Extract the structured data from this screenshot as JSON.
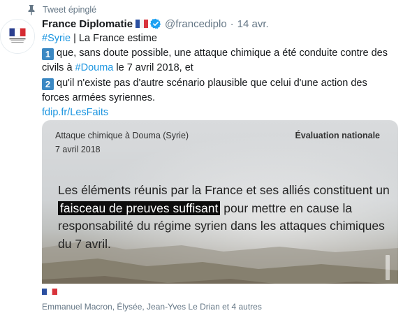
{
  "pinned": {
    "label": "Tweet épinglé"
  },
  "author": {
    "name": "France Diplomatie",
    "handle": "@francediplo",
    "separator": "·",
    "time": "14 avr."
  },
  "tweet": {
    "line1_tag": "#Syrie",
    "line1_rest": " | La France estime",
    "num1": "1",
    "point1_a": "que, sans doute possible, une attaque chimique a été conduite contre des civils à ",
    "point1_tag": "#Douma",
    "point1_b": " le 7 avril 2018, et",
    "num2": "2",
    "point2": "qu'il n'existe pas d'autre scénario plausible que celui d'une action des forces armées syriennes.",
    "link": "fdip.fr/LesFaits"
  },
  "media": {
    "title": "Attaque chimique à Douma (Syrie)",
    "date": "7 avril 2018",
    "badge": "Évaluation nationale",
    "text_a": "Les éléments réunis par la France et ses alliés constituent un ",
    "text_highlight": "faisceau de preuves suffisant",
    "text_b": " pour mettre en cause la responsabilité du régime syrien dans les attaques chimiques du 7 avril."
  },
  "tagged_people": "Emmanuel Macron, Élysée, Jean-Yves Le Drian et 4 autres",
  "colors": {
    "link": "#1b95e0",
    "muted": "#657786",
    "verified": "#1da1f2",
    "keycap": "#3b88c3"
  },
  "icons": {
    "pin": "pin-icon",
    "verified": "verified-badge-icon",
    "flag": "french-flag-icon"
  }
}
